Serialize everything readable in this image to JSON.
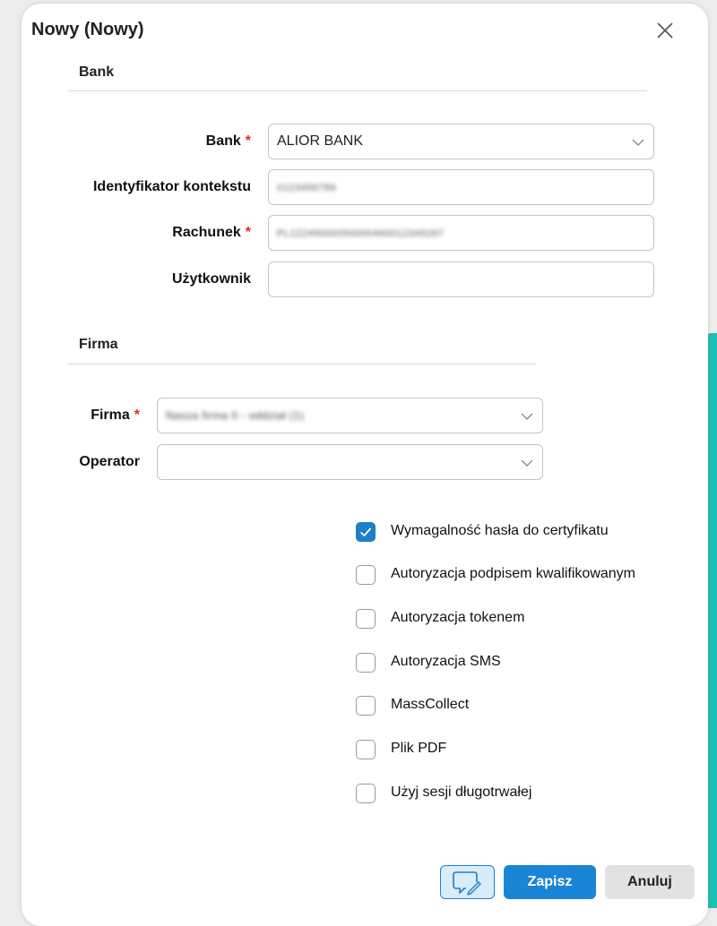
{
  "dialog": {
    "title": "Nowy (Nowy)"
  },
  "bank_section": {
    "heading": "Bank",
    "fields": {
      "bank": {
        "label": "Bank",
        "required_mark": "*",
        "value": "ALIOR BANK"
      },
      "context_id": {
        "label": "Identyfikator kontekstu",
        "value": "0123456789"
      },
      "account": {
        "label": "Rachunek",
        "required_mark": "*",
        "value": "PL12249000050000460012345267"
      },
      "user": {
        "label": "Użytkownik",
        "value": ""
      }
    }
  },
  "company_section": {
    "heading": "Firma",
    "fields": {
      "company": {
        "label": "Firma",
        "required_mark": "*",
        "value": "Nasza firma 0 - oddział (1)"
      },
      "operator": {
        "label": "Operator",
        "value": ""
      }
    }
  },
  "options": [
    {
      "label": "Wymagalność hasła do certyfikatu",
      "checked": true
    },
    {
      "label": "Autoryzacja podpisem kwalifikowanym",
      "checked": false
    },
    {
      "label": "Autoryzacja tokenem",
      "checked": false
    },
    {
      "label": "Autoryzacja SMS",
      "checked": false
    },
    {
      "label": "MassCollect",
      "checked": false
    },
    {
      "label": "Plik PDF",
      "checked": false
    },
    {
      "label": "Użyj sesji długotrwałej",
      "checked": false
    }
  ],
  "footer": {
    "save_label": "Zapisz",
    "cancel_label": "Anuluj"
  },
  "icons": {
    "close": "close-icon",
    "dropdown": "chevron-down-icon",
    "note": "note-edit-icon"
  },
  "colors": {
    "accent": "#1a85d6",
    "required": "#d92c2c",
    "side_accent": "#1fbfb3"
  }
}
